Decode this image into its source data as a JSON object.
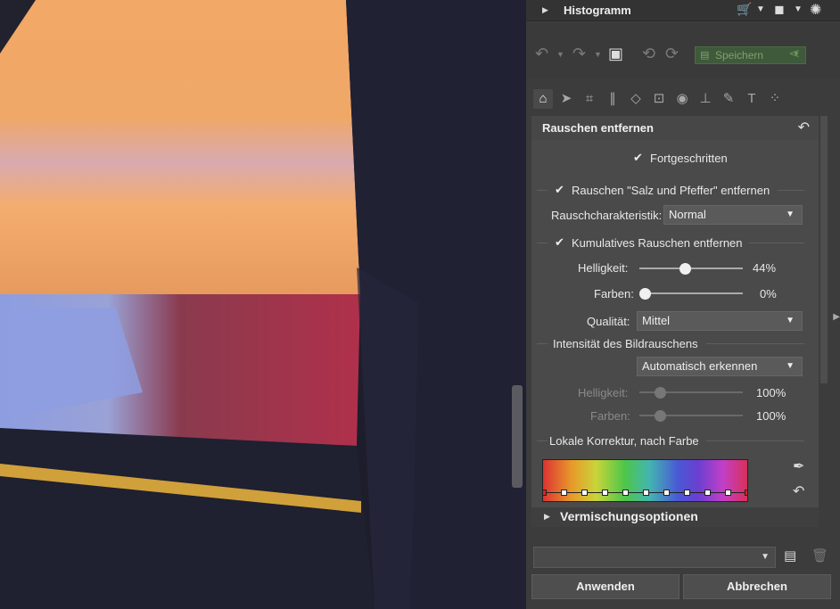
{
  "histogram": {
    "title": "Histogramm",
    "icons": [
      "cart-icon",
      "chevron-down-icon",
      "square-icon",
      "chevron-down-icon",
      "sun-icon"
    ]
  },
  "toolbar": {
    "save_label": "Speichern",
    "icons": [
      "undo-icon",
      "redo-icon",
      "image-icon",
      "rotate-left-icon",
      "rotate-right-icon",
      "share-icon"
    ]
  },
  "tools": {
    "icons": [
      "home-icon",
      "pointer-icon",
      "crop-icon",
      "perspective-icon",
      "transform-icon",
      "export-icon",
      "eye-icon",
      "stamp-icon",
      "brush-icon",
      "text-icon",
      "dots-icon"
    ]
  },
  "section": {
    "title": "Rauschen entfernen",
    "advanced_label": "Fortgeschritten",
    "salt_pepper_label": "Rauschen \"Salz und Pfeffer\" entfernen",
    "noise_type_label": "Rauschcharakteristik:",
    "noise_type_value": "Normal",
    "cumulative_label": "Kumulatives Rauschen entfernen",
    "brightness_label": "Helligkeit:",
    "brightness_value": "44%",
    "brightness_level": 0.44,
    "colors_label": "Farben:",
    "colors_value": "0%",
    "colors_level": 0.0,
    "quality_label": "Qualität:",
    "quality_value": "Mittel",
    "intensity_label": "Intensität des Bildrauschens",
    "intensity_value": "Automatisch erkennen",
    "intensity_brightness_label": "Helligkeit:",
    "intensity_brightness_value": "100%",
    "intensity_colors_label": "Farben:",
    "intensity_colors_value": "100%",
    "local_label": "Lokale Korrektur, nach Farbe"
  },
  "blend": {
    "title": "Vermischungsoptionen"
  },
  "footer": {
    "apply_label": "Anwenden",
    "cancel_label": "Abbrechen"
  }
}
